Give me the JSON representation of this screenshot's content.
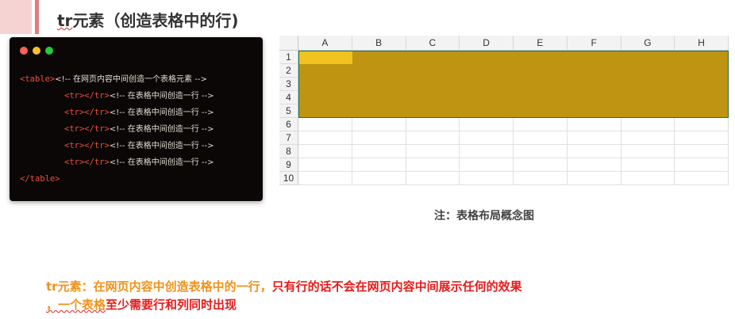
{
  "header": {
    "title_tr": "tr",
    "title_rest": "元素（创造表格中的行)"
  },
  "code": {
    "lines": [
      {
        "tag": "<table>",
        "comment": "<!-- 在网页内容中间创造一个表格元素 -->"
      },
      {
        "tag": "<tr></tr>",
        "comment": "<!-- 在表格中间创造一行 -->"
      },
      {
        "tag": "<tr></tr>",
        "comment": "<!-- 在表格中间创造一行 -->"
      },
      {
        "tag": "<tr></tr>",
        "comment": "<!-- 在表格中间创造一行 -->"
      },
      {
        "tag": "<tr></tr>",
        "comment": "<!-- 在表格中间创造一行 -->"
      },
      {
        "tag": "<tr></tr>",
        "comment": "<!-- 在表格中间创造一行 -->"
      },
      {
        "tag": "</table>",
        "comment": ""
      }
    ]
  },
  "sheet": {
    "columns": [
      "A",
      "B",
      "C",
      "D",
      "E",
      "F",
      "G",
      "H"
    ],
    "rows": [
      "1",
      "2",
      "3",
      "4",
      "5",
      "6",
      "7",
      "8",
      "9",
      "10"
    ],
    "highlighted_rows": 5,
    "highlight_color": "#be9412",
    "active_cell_color": "#f0c321"
  },
  "caption": "注：表格布局概念图",
  "note": {
    "line1_orange": "tr元素：在网页内容中创造表格中的一行，",
    "line1_red": "只有行的话不会在网页内容中间展示任何的效果",
    "line2_orange": "，一个表格",
    "line2_red": "至少需要行和列同时出现"
  }
}
